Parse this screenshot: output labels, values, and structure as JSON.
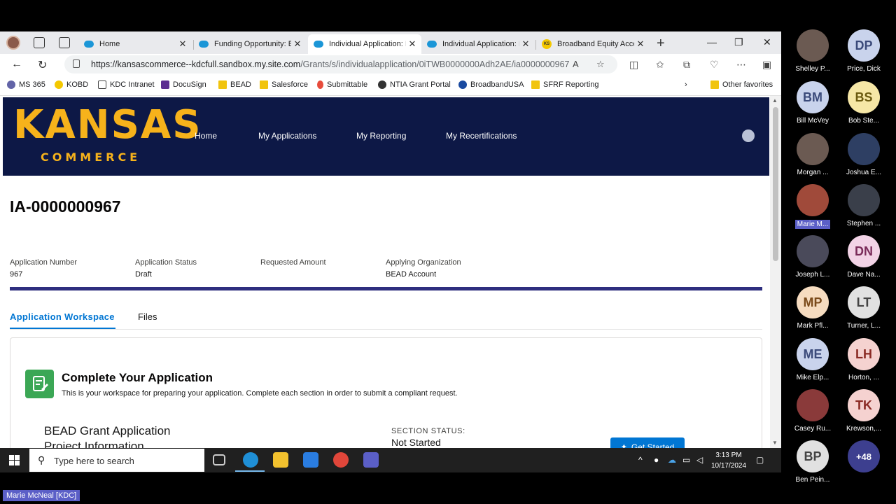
{
  "browser": {
    "tabs": [
      {
        "label": "Home"
      },
      {
        "label": "Funding Opportunity: BEAD"
      },
      {
        "label": "Individual Application: IA"
      },
      {
        "label": "Individual Application: IA"
      },
      {
        "label": "Broadband Equity Access"
      }
    ],
    "url_host": "https://kansascommerce--kdcfull.sandbox.my.site.com",
    "url_path": "/Grants/s/individualapplication/0iTWB0000000Adh2AE/ia0000000967",
    "favorites": [
      {
        "label": "MS 365",
        "color": "#6264a7"
      },
      {
        "label": "KOBD",
        "color": "#f4c800"
      },
      {
        "label": "KDC Intranet",
        "color": "#ffffff"
      },
      {
        "label": "DocuSign",
        "color": "#5c2d91"
      },
      {
        "label": "BEAD",
        "color": "#f1c40f"
      },
      {
        "label": "Salesforce",
        "color": "#f1c40f"
      },
      {
        "label": "Submittable",
        "color": "#e74c3c"
      },
      {
        "label": "NTIA Grant Portal",
        "color": "#333333"
      },
      {
        "label": "BroadbandUSA",
        "color": "#1a4aa0"
      },
      {
        "label": "SFRF Reporting",
        "color": "#f1c40f"
      }
    ],
    "other_favorites": "Other favorites"
  },
  "site": {
    "logo_main": "KANSAS",
    "logo_sub": "COMMERCE",
    "nav": [
      "Home",
      "My Applications",
      "My Reporting",
      "My Recertifications"
    ]
  },
  "application": {
    "title": "IA-0000000967",
    "fields": [
      {
        "label": "Application Number",
        "value": "967"
      },
      {
        "label": "Application Status",
        "value": "Draft"
      },
      {
        "label": "Requested Amount",
        "value": ""
      },
      {
        "label": "Applying Organization",
        "value": "BEAD Account"
      }
    ],
    "tabs": [
      "Application Workspace",
      "Files"
    ],
    "card_title": "Complete Your Application",
    "card_subtitle": "This is your workspace for preparing your application.  Complete each section in order to submit a compliant request.",
    "section_line1": "BEAD Grant Application",
    "section_line2": "Project Information",
    "section_status_label": "SECTION STATUS:",
    "section_status_value": "Not Started",
    "get_started": "Get Started"
  },
  "taskbar": {
    "search_placeholder": "Type here to search",
    "time": "3:13 PM",
    "date": "10/17/2024"
  },
  "participants": [
    {
      "initials": "",
      "name": "Shelley P...",
      "photo": true
    },
    {
      "initials": "DP",
      "name": "Price, Dick",
      "bg": "#c9d3ec",
      "fg": "#3b4a7a"
    },
    {
      "initials": "BM",
      "name": "Bill McVey",
      "bg": "#c9d3ec",
      "fg": "#3b4a7a"
    },
    {
      "initials": "BS",
      "name": "Bob Ste...",
      "bg": "#f6e7a6",
      "fg": "#6b5a10"
    },
    {
      "initials": "",
      "name": "Morgan ...",
      "photo": true
    },
    {
      "initials": "",
      "name": "Joshua E...",
      "photo": true
    },
    {
      "initials": "",
      "name": "Marie M...",
      "photo": true,
      "highlight": true
    },
    {
      "initials": "",
      "name": "Stephen ...",
      "photo": true
    },
    {
      "initials": "",
      "name": "Joseph L...",
      "photo": true
    },
    {
      "initials": "DN",
      "name": "Dave Na...",
      "bg": "#f2d3e6",
      "fg": "#7a2c5a"
    },
    {
      "initials": "MP",
      "name": "Mark Pfl...",
      "bg": "#f6dcc0",
      "fg": "#7a4a1a"
    },
    {
      "initials": "LT",
      "name": "Turner, L...",
      "bg": "#e1e1e1",
      "fg": "#444444"
    },
    {
      "initials": "ME",
      "name": "Mike Elp...",
      "bg": "#c9d3ec",
      "fg": "#3b4a7a"
    },
    {
      "initials": "LH",
      "name": "Horton, ...",
      "bg": "#f5d2d0",
      "fg": "#8a2a24"
    },
    {
      "initials": "",
      "name": "Casey Ru...",
      "photo": true
    },
    {
      "initials": "TK",
      "name": "Krewson,...",
      "bg": "#f5d2d0",
      "fg": "#8a2a24"
    },
    {
      "initials": "BP",
      "name": "Ben Pein...",
      "bg": "#e1e1e1",
      "fg": "#444444"
    },
    {
      "initials": "+48",
      "name": "",
      "bg": "#3d3f8f",
      "fg": "#ffffff"
    }
  ],
  "presenter_tag": "Marie McNeal [KDC]"
}
